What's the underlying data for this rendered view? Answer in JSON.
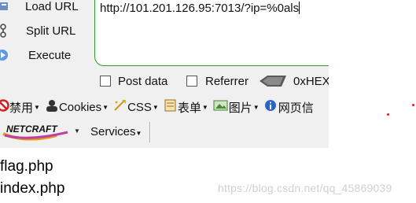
{
  "sidebar": {
    "items": [
      {
        "label": "Load URL",
        "icon": "load-url-icon"
      },
      {
        "label": "Split URL",
        "icon": "split-url-icon"
      },
      {
        "label": "Execute",
        "icon": "execute-icon"
      }
    ]
  },
  "url": {
    "value": "http://101.201.126.95:7013/?ip=%0als"
  },
  "options": {
    "post_data": "Post data",
    "referrer": "Referrer",
    "hex": "0xHEX"
  },
  "menu": {
    "items": [
      {
        "label": "禁用",
        "icon": "disable-icon"
      },
      {
        "label": "Cookies",
        "icon": "cookies-icon"
      },
      {
        "label": "CSS",
        "icon": "css-icon"
      },
      {
        "label": "表单",
        "icon": "form-icon"
      },
      {
        "label": "图片",
        "icon": "image-icon"
      },
      {
        "label": "网页信",
        "icon": "info-icon"
      }
    ]
  },
  "netcraft": {
    "logo": "NETCRAFT",
    "services": "Services"
  },
  "output": {
    "lines": [
      "flag.php",
      "index.php"
    ]
  },
  "watermark": "https://blog.csdn.net/qq_45869039",
  "colors": {
    "url_border": "#2a9d2a",
    "toolbar_bg": "#f0f0f0",
    "dot": "#d81e1e"
  }
}
